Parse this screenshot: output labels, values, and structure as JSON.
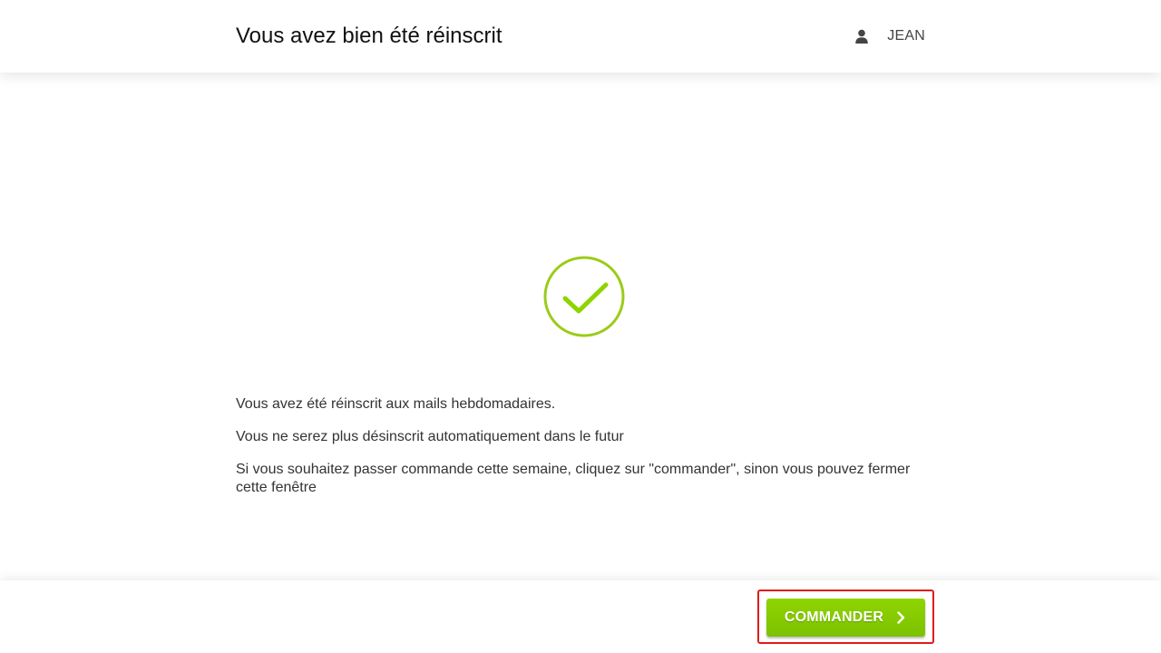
{
  "header": {
    "title": "Vous avez bien été réinscrit",
    "user_icon": "user-icon",
    "user_name": "JEAN"
  },
  "main": {
    "status_icon": "check-circle-icon",
    "accent_color": "#8fcc0f",
    "messages": [
      "Vous avez été réinscrit aux mails hebdomadaires.",
      "Vous ne serez plus désinscrit automatiquement dans le futur",
      "Si vous souhaitez passer commande cette semaine, cliquez sur \"commander\", sinon vous pouvez fermer cette fenêtre"
    ]
  },
  "footer": {
    "order_button_label": "COMMANDER",
    "order_button_icon": "chevron-right-icon",
    "button_color": "#88cc00",
    "focus_ring_color": "#e01b1b"
  }
}
